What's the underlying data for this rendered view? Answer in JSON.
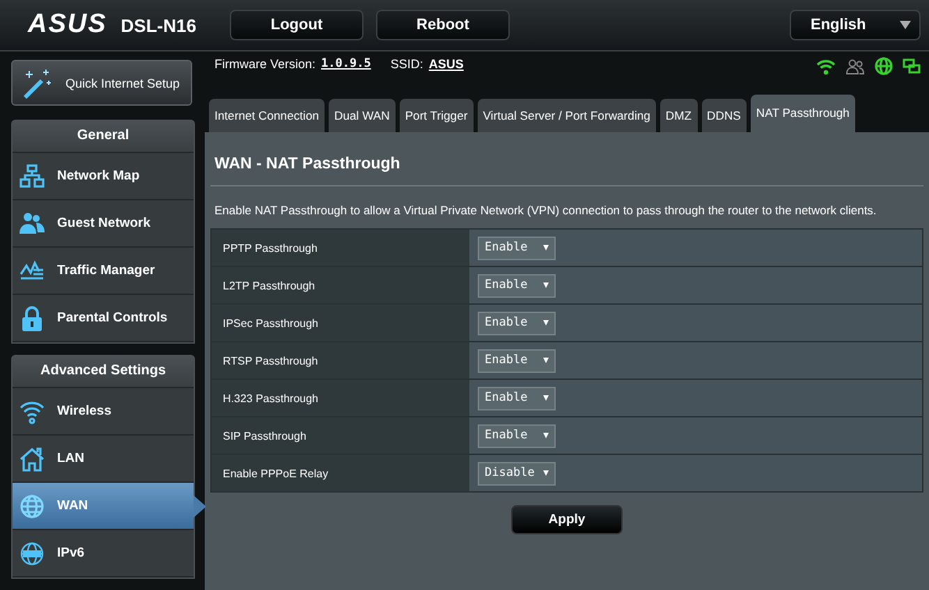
{
  "header": {
    "logo": "ASUS",
    "model": "DSL-N16",
    "buttons": [
      "Logout",
      "Reboot"
    ],
    "language": "English"
  },
  "quick_setup": {
    "label": "Quick Internet Setup"
  },
  "info": {
    "firmware_label": "Firmware Version:",
    "firmware": "1.0.9.5",
    "ssid_label": "SSID:",
    "ssid": "ASUS"
  },
  "sidebar": [
    {
      "title": "General",
      "items": [
        {
          "label": "Network Map",
          "kind": "map",
          "selected": false
        },
        {
          "label": "Guest Network",
          "kind": "guests",
          "selected": false
        },
        {
          "label": "Traffic Manager",
          "kind": "traffic",
          "selected": false
        },
        {
          "label": "Parental Controls",
          "kind": "lock",
          "selected": false
        }
      ]
    },
    {
      "title": "Advanced Settings",
      "items": [
        {
          "label": "Wireless",
          "kind": "wifi",
          "selected": false
        },
        {
          "label": "LAN",
          "kind": "house",
          "selected": false
        },
        {
          "label": "WAN",
          "kind": "globe",
          "selected": true
        },
        {
          "label": "IPv6",
          "kind": "ipv6",
          "selected": false
        }
      ]
    }
  ],
  "tabs": [
    {
      "label": "Internet Connection",
      "selected": false
    },
    {
      "label": "Dual WAN",
      "selected": false
    },
    {
      "label": "Port Trigger",
      "selected": false
    },
    {
      "label": "Virtual Server / Port Forwarding",
      "selected": false
    },
    {
      "label": "DMZ",
      "selected": false
    },
    {
      "label": "DDNS",
      "selected": false
    },
    {
      "label": "NAT Passthrough",
      "selected": true
    }
  ],
  "panel": {
    "title": "WAN - NAT Passthrough",
    "description": "Enable NAT Passthrough to allow a Virtual Private Network (VPN) connection to pass through the router to the network clients.",
    "rows": [
      {
        "label": "PPTP Passthrough",
        "value": "Enable"
      },
      {
        "label": "L2TP Passthrough",
        "value": "Enable"
      },
      {
        "label": "IPSec Passthrough",
        "value": "Enable"
      },
      {
        "label": "RTSP Passthrough",
        "value": "Enable"
      },
      {
        "label": "H.323 Passthrough",
        "value": "Enable"
      },
      {
        "label": "SIP Passthrough",
        "value": "Enable"
      },
      {
        "label": "Enable PPPoE Relay",
        "value": "Disable"
      }
    ],
    "apply": "Apply"
  }
}
